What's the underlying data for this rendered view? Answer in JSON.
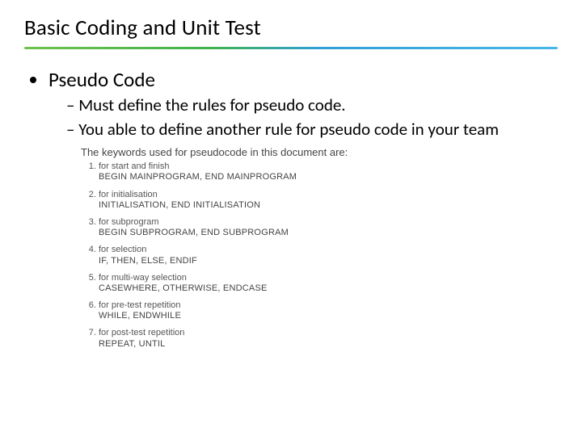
{
  "title": "Basic Coding and Unit Test",
  "bullets": {
    "main": "Pseudo Code",
    "subs": [
      "Must define the rules for pseudo code.",
      "You able to define another rule for pseudo code in your team"
    ]
  },
  "doc": {
    "intro": "The keywords used for pseudocode in this document are:",
    "items": [
      {
        "label": "for start and finish",
        "code": "BEGIN MAINPROGRAM, END MAINPROGRAM"
      },
      {
        "label": "for initialisation",
        "code": "INITIALISATION, END INITIALISATION"
      },
      {
        "label": "for subprogram",
        "code": "BEGIN SUBPROGRAM, END SUBPROGRAM"
      },
      {
        "label": "for selection",
        "code": "IF, THEN, ELSE, ENDIF"
      },
      {
        "label": "for multi-way selection",
        "code": "CASEWHERE, OTHERWISE, ENDCASE"
      },
      {
        "label": "for pre-test repetition",
        "code": "WHILE, ENDWHILE"
      },
      {
        "label": "for post-test repetition",
        "code": "REPEAT, UNTIL"
      }
    ]
  }
}
